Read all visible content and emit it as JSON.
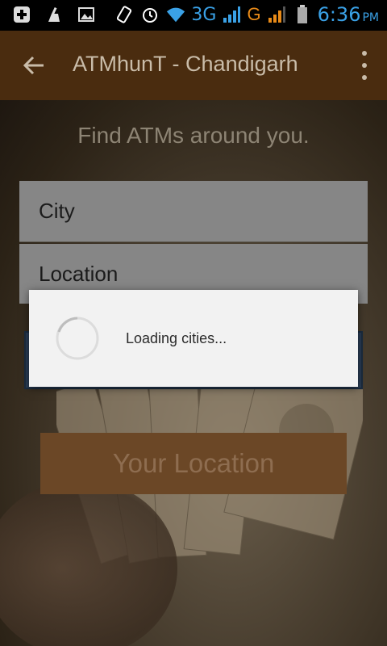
{
  "status_bar": {
    "network_3g": "3G",
    "network_g": "G",
    "time": "6:36",
    "ampm": "PM",
    "icons": [
      "add-notification-icon",
      "clean-icon",
      "image-icon",
      "vibrate-icon",
      "alarm-icon",
      "wifi-icon",
      "signal-icon",
      "signal-icon",
      "battery-icon"
    ]
  },
  "app_bar": {
    "title": "ATMhunT - Chandigarh",
    "back_icon": "arrow-left-icon",
    "menu_icon": "more-vert-icon"
  },
  "main": {
    "subtitle": "Find ATMs around you.",
    "city_field": "City",
    "location_field": "Location",
    "your_location_button": "Your Location"
  },
  "dialog": {
    "message": "Loading cities..."
  },
  "colors": {
    "app_bar": "#4a2c0f",
    "status_accent": "#3aa1e6",
    "dialog_bg": "#f2f2f2",
    "location_button": "#6b4726"
  }
}
